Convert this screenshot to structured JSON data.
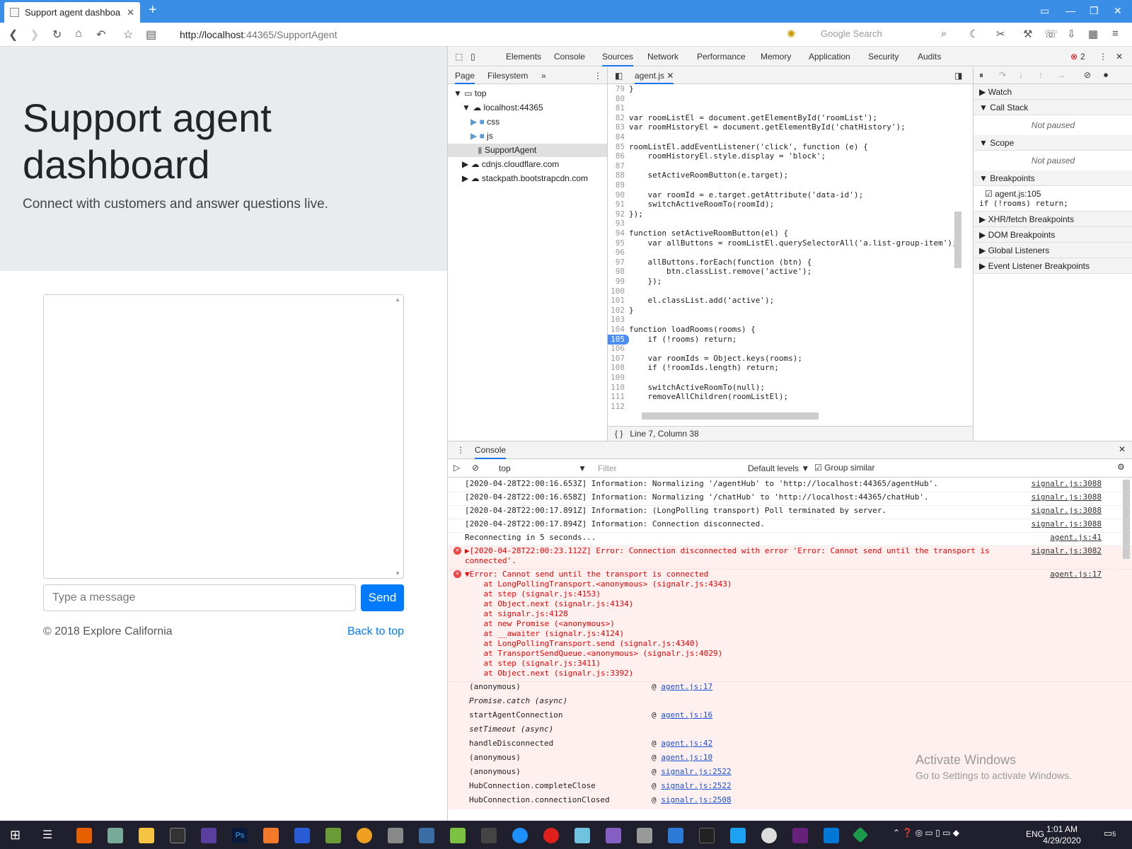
{
  "browser": {
    "tab_title": "Support agent dashboa",
    "url_prefix": "http://localhost",
    "url_rest": ":44365/SupportAgent",
    "search_placeholder": "Google Search"
  },
  "page": {
    "heading": "Support agent dashboard",
    "lead": "Connect with customers and answer questions live.",
    "message_placeholder": "Type a message",
    "send_label": "Send",
    "footer_copy": "© 2018 Explore California",
    "back_to_top": "Back to top"
  },
  "devtools": {
    "tabs": [
      "Elements",
      "Console",
      "Sources",
      "Network",
      "Performance",
      "Memory",
      "Application",
      "Security",
      "Audits"
    ],
    "active_tab": "Sources",
    "error_count": "2",
    "nav_tabs": [
      "Page",
      "Filesystem"
    ],
    "tree": [
      {
        "label": "top",
        "depth": 0
      },
      {
        "label": "localhost:44365",
        "depth": 1
      },
      {
        "label": "css",
        "depth": 2
      },
      {
        "label": "js",
        "depth": 2
      },
      {
        "label": "SupportAgent",
        "depth": 3
      },
      {
        "label": "cdnjs.cloudflare.com",
        "depth": 1
      },
      {
        "label": "stackpath.bootstrapcdn.com",
        "depth": 1
      }
    ],
    "file_tab": "agent.js",
    "status": "Line 7, Column 38",
    "sidebar": {
      "watch": "Watch",
      "call_stack": "Call Stack",
      "not_paused": "Not paused",
      "scope": "Scope",
      "breakpoints": "Breakpoints",
      "bp_file": "agent.js:105",
      "bp_code": "if (!rooms) return;",
      "xhr": "XHR/fetch Breakpoints",
      "dom": "DOM Breakpoints",
      "global": "Global Listeners",
      "event": "Event Listener Breakpoints"
    },
    "code_lines": [
      {
        "n": "79",
        "t": "}"
      },
      {
        "n": "80",
        "t": ""
      },
      {
        "n": "81",
        "t": ""
      },
      {
        "n": "82",
        "t": "var roomListEl = document.getElementById('roomList');"
      },
      {
        "n": "83",
        "t": "var roomHistoryEl = document.getElementById('chatHistory');"
      },
      {
        "n": "84",
        "t": ""
      },
      {
        "n": "85",
        "t": "roomListEl.addEventListener('click', function (e) {"
      },
      {
        "n": "86",
        "t": "    roomHistoryEl.style.display = 'block';"
      },
      {
        "n": "87",
        "t": ""
      },
      {
        "n": "88",
        "t": "    setActiveRoomButton(e.target);"
      },
      {
        "n": "89",
        "t": ""
      },
      {
        "n": "90",
        "t": "    var roomId = e.target.getAttribute('data-id');"
      },
      {
        "n": "91",
        "t": "    switchActiveRoomTo(roomId);"
      },
      {
        "n": "92",
        "t": "});"
      },
      {
        "n": "93",
        "t": ""
      },
      {
        "n": "94",
        "t": "function setActiveRoomButton(el) {"
      },
      {
        "n": "95",
        "t": "    var allButtons = roomListEl.querySelectorAll('a.list-group-item');"
      },
      {
        "n": "96",
        "t": ""
      },
      {
        "n": "97",
        "t": "    allButtons.forEach(function (btn) {"
      },
      {
        "n": "98",
        "t": "        btn.classList.remove('active');"
      },
      {
        "n": "99",
        "t": "    });"
      },
      {
        "n": "100",
        "t": ""
      },
      {
        "n": "101",
        "t": "    el.classList.add('active');"
      },
      {
        "n": "102",
        "t": "}"
      },
      {
        "n": "103",
        "t": ""
      },
      {
        "n": "104",
        "t": "function loadRooms(rooms) {"
      },
      {
        "n": "105",
        "t": "    if (!rooms) return;"
      },
      {
        "n": "106",
        "t": ""
      },
      {
        "n": "107",
        "t": "    var roomIds = Object.keys(rooms);"
      },
      {
        "n": "108",
        "t": "    if (!roomIds.length) return;"
      },
      {
        "n": "109",
        "t": ""
      },
      {
        "n": "110",
        "t": "    switchActiveRoomTo(null);"
      },
      {
        "n": "111",
        "t": "    removeAllChildren(roomListEl);"
      },
      {
        "n": "112",
        "t": ""
      }
    ],
    "breakpoint_line": "105",
    "console": {
      "title": "Console",
      "context": "top",
      "filter_placeholder": "Filter",
      "levels": "Default levels",
      "group_similar": "Group similar",
      "rows": [
        {
          "type": "info",
          "text": "[2020-04-28T22:00:16.653Z] Information: Normalizing '/agentHub' to 'http://localhost:44365/agentHub'.",
          "src": "signalr.js:3088"
        },
        {
          "type": "info",
          "text": "[2020-04-28T22:00:16.658Z] Information: Normalizing '/chatHub' to 'http://localhost:44365/chatHub'.",
          "src": "signalr.js:3088"
        },
        {
          "type": "info",
          "text": "[2020-04-28T22:00:17.891Z] Information: (LongPolling transport) Poll terminated by server.",
          "src": "signalr.js:3088"
        },
        {
          "type": "info",
          "text": "[2020-04-28T22:00:17.894Z] Information: Connection disconnected.",
          "src": "signalr.js:3088"
        },
        {
          "type": "info",
          "text": "Reconnecting in 5 seconds...",
          "src": "agent.js:41"
        },
        {
          "type": "error",
          "text": "▶[2020-04-28T22:00:23.112Z] Error: Connection disconnected with error 'Error: Cannot send until the transport is\nconnected'.",
          "src": "signalr.js:3082"
        },
        {
          "type": "error",
          "text": "▼Error: Cannot send until the transport is connected\n    at LongPollingTransport.<anonymous> (signalr.js:4343)\n    at step (signalr.js:4153)\n    at Object.next (signalr.js:4134)\n    at signalr.js:4128\n    at new Promise (<anonymous>)\n    at __awaiter (signalr.js:4124)\n    at LongPollingTransport.send (signalr.js:4340)\n    at TransportSendQueue.<anonymous> (signalr.js:4029)\n    at step (signalr.js:3411)\n    at Object.next (signalr.js:3392)",
          "src": "agent.js:17"
        }
      ],
      "stack": [
        {
          "fn": "(anonymous)",
          "src": "agent.js:17"
        },
        {
          "fn": "Promise.catch (async)",
          "src": ""
        },
        {
          "fn": "startAgentConnection",
          "src": "agent.js:16"
        },
        {
          "fn": "setTimeout (async)",
          "src": ""
        },
        {
          "fn": "handleDisconnected",
          "src": "agent.js:42"
        },
        {
          "fn": "(anonymous)",
          "src": "agent.js:10"
        },
        {
          "fn": "(anonymous)",
          "src": "signalr.js:2522"
        },
        {
          "fn": "HubConnection.completeClose",
          "src": "signalr.js:2522"
        },
        {
          "fn": "HubConnection.connectionClosed",
          "src": "signalr.js:2508"
        }
      ]
    }
  },
  "watermark": {
    "title": "Activate Windows",
    "subtitle": "Go to Settings to activate Windows."
  },
  "taskbar": {
    "lang": "ENG",
    "time": "1:01 AM",
    "date": "4/29/2020",
    "notif": "5"
  },
  "colors": {
    "accent": "#007bff",
    "titlebar": "#3a8ee6",
    "error": "#e00",
    "taskbar": "#1f1f2e"
  }
}
